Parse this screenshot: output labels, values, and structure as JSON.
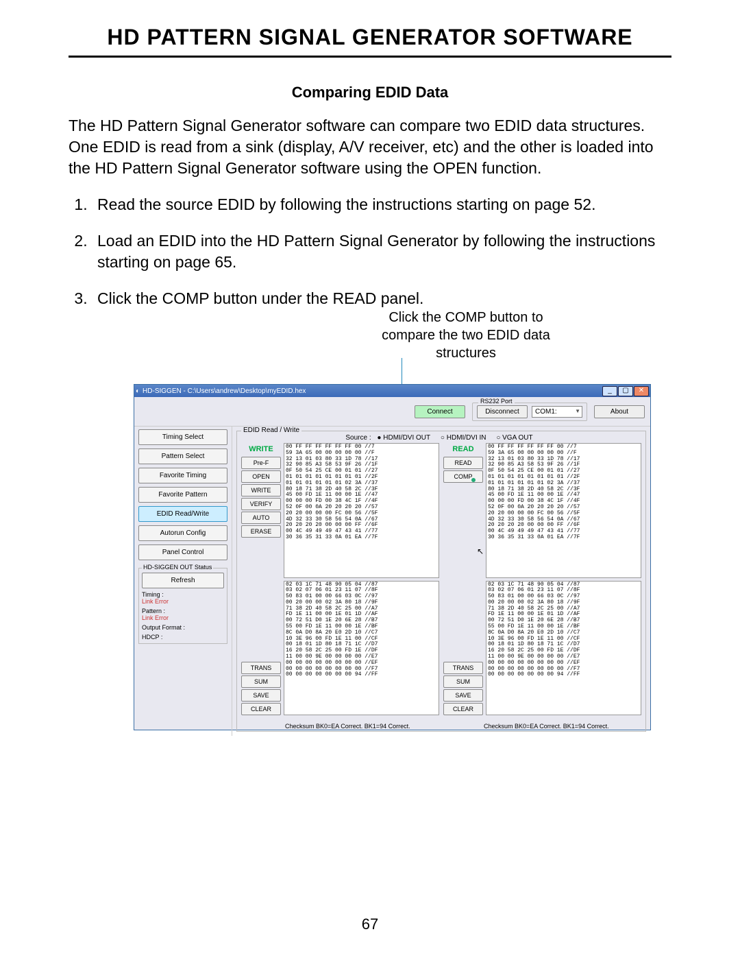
{
  "doc": {
    "title": "HD PATTERN SIGNAL GENERATOR SOFTWARE",
    "section": "Comparing EDID Data",
    "intro": "The HD Pattern Signal Generator software can compare two EDID data structures. One EDID is read from a sink (display, A/V receiver, etc) and the other is loaded into the HD Pattern Signal Generator software using the OPEN function.",
    "steps": [
      "Read the source EDID by following the instructions starting on page 52.",
      "Load an EDID into the HD Pattern Signal Generator by following the instructions starting on page 65.",
      "Click the COMP button under the READ panel."
    ],
    "callout": "Click the COMP button to compare the two EDID data structures",
    "page": "67"
  },
  "app": {
    "title": "HD-SIGGEN - C:\\Users\\andrew\\Desktop\\myEDID.hex",
    "toolbar": {
      "connect": "Connect",
      "disconnect": "Disconnect",
      "port_label": "RS232 Port",
      "port": "COM1:",
      "about": "About"
    },
    "sidebar": {
      "items": [
        "Timing Select",
        "Pattern Select",
        "Favorite Timing",
        "Favorite Pattern",
        "EDID Read/Write",
        "Autorun Config",
        "Panel Control"
      ],
      "active_index": 4,
      "status_legend": "HD-SIGGEN OUT Status",
      "refresh": "Refresh",
      "lines": [
        {
          "label": "Timing :",
          "err": "Link Error"
        },
        {
          "label": "Pattern :",
          "err": "Link Error"
        },
        {
          "label": "Output Format :",
          "err": ""
        },
        {
          "label": "HDCP :",
          "err": ""
        }
      ]
    },
    "edid": {
      "legend": "EDID Read / Write",
      "source_label": "Source :",
      "sources": [
        "HDMI/DVI OUT",
        "HDMI/DVI IN",
        "VGA OUT"
      ],
      "write_head": "WRITE",
      "read_head": "READ",
      "write_btns": [
        "Pre-F",
        "OPEN",
        "WRITE",
        "VERIFY",
        "AUTO",
        "ERASE",
        "TRANS",
        "SUM",
        "SAVE",
        "CLEAR"
      ],
      "read_btns": [
        "READ",
        "COMP",
        "TRANS",
        "SUM",
        "SAVE",
        "CLEAR"
      ],
      "hex_block1": "00 FF FF FF FF FF FF 00 //7\n59 3A 65 00 00 00 00 00 //F\n32 13 01 03 80 33 1D 78 //17\n32 90 85 A3 58 53 9F 26 //1F\n0F 50 54 25 CE 00 01 01 //27\n01 01 01 01 01 01 01 01 //2F\n01 01 01 01 01 01 02 3A //37\n80 18 71 38 2D 40 58 2C //3F\n45 00 FD 1E 11 00 00 1E //47\n00 00 00 FD 00 38 4C 1F //4F\n52 0F 00 0A 20 20 20 20 //57\n20 20 00 00 00 FC 00 56 //5F\n4D 32 33 30 58 56 54 0A //67\n20 20 20 20 00 00 00 FF //6F\n00 4C 49 49 49 47 43 41 //77\n30 36 35 31 33 0A 01 EA //7F",
      "hex_block2": "02 03 1C 71 48 90 05 04 //87\n03 02 07 06 01 23 11 07 //8F\n50 83 01 00 00 66 03 0C //97\n00 20 00 00 02 3A 80 18 //9F\n71 38 2D 40 58 2C 25 00 //A7\nFD 1E 11 00 00 1E 01 1D //AF\n00 72 51 D0 1E 20 6E 28 //B7\n55 00 FD 1E 11 00 00 1E //BF\n8C 0A D0 8A 20 E0 2D 10 //C7\n10 3E 96 00 FD 1E 11 00 //CF\n00 18 01 1D 80 18 71 1C //D7\n16 20 58 2C 25 00 FD 1E //DF\n11 00 00 9E 00 00 00 00 //E7\n00 00 00 00 00 00 00 00 //EF\n00 00 00 00 00 00 00 00 //F7\n00 00 00 00 00 00 00 94 //FF",
      "checksum_left": "Checksum BK0=EA Correct.     BK1=94 Correct.",
      "checksum_right": "Checksum BK0=EA Correct.     BK1=94 Correct."
    }
  }
}
